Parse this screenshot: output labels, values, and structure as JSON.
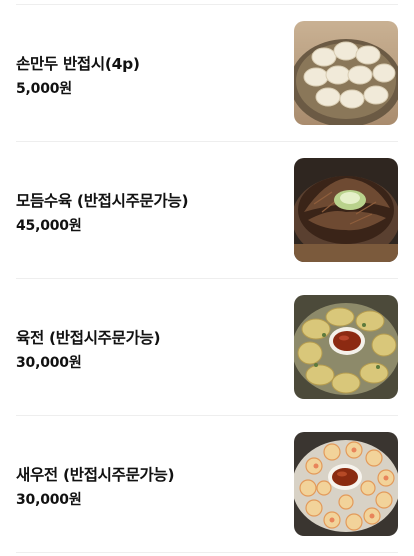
{
  "menu": {
    "items": [
      {
        "name": "손만두 반접시(4p)",
        "price": "5,000원",
        "image": "dumplings-photo"
      },
      {
        "name": "모듬수육 (반접시주문가능)",
        "price": "45,000원",
        "image": "boiled-pork-platter-photo"
      },
      {
        "name": "육전 (반접시주문가능)",
        "price": "30,000원",
        "image": "beef-jeon-photo"
      },
      {
        "name": "새우전 (반접시주문가능)",
        "price": "30,000원",
        "image": "shrimp-jeon-photo"
      }
    ]
  }
}
